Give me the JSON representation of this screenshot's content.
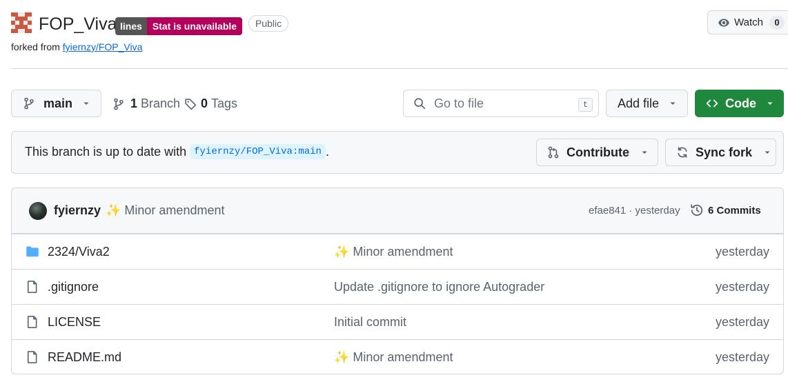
{
  "repo": {
    "name": "FOP_Viva",
    "badge_left": "lines",
    "badge_right": "Stat is unavailable",
    "visibility": "Public",
    "forked_prefix": "forked from",
    "forked_source": "fyiernzy/FOP_Viva"
  },
  "watch": {
    "label": "Watch",
    "count": "0"
  },
  "toolbar": {
    "branch": "main",
    "branch_count": "1",
    "branch_label": "Branch",
    "tag_count": "0",
    "tag_label": "Tags",
    "search_placeholder": "Go to file",
    "search_kbd": "t",
    "add_file": "Add file",
    "code": "Code"
  },
  "sync": {
    "text": "This branch is up to date with",
    "ref": "fyiernzy/FOP_Viva:main",
    "suffix": ".",
    "contribute": "Contribute",
    "sync_fork": "Sync fork"
  },
  "latest_commit": {
    "author": "fyiernzy",
    "message": "✨ Minor amendment",
    "hash_time": "efae841 · yesterday",
    "commits_count": "6 Commits"
  },
  "files": [
    {
      "name": "2324/Viva2",
      "type": "folder",
      "message": "✨ Minor amendment",
      "date": "yesterday"
    },
    {
      "name": ".gitignore",
      "type": "file",
      "message": "Update .gitignore to ignore Autograder",
      "date": "yesterday"
    },
    {
      "name": "LICENSE",
      "type": "file",
      "message": "Initial commit",
      "date": "yesterday"
    },
    {
      "name": "README.md",
      "type": "file",
      "message": "✨ Minor amendment",
      "date": "yesterday"
    }
  ],
  "colors": {
    "accent_green": "#1f883d",
    "link_blue": "#0969da",
    "folder_blue": "#54aeff",
    "badge_grey": "#555555",
    "badge_magenta": "#b4005a",
    "border": "#d0d7de"
  }
}
